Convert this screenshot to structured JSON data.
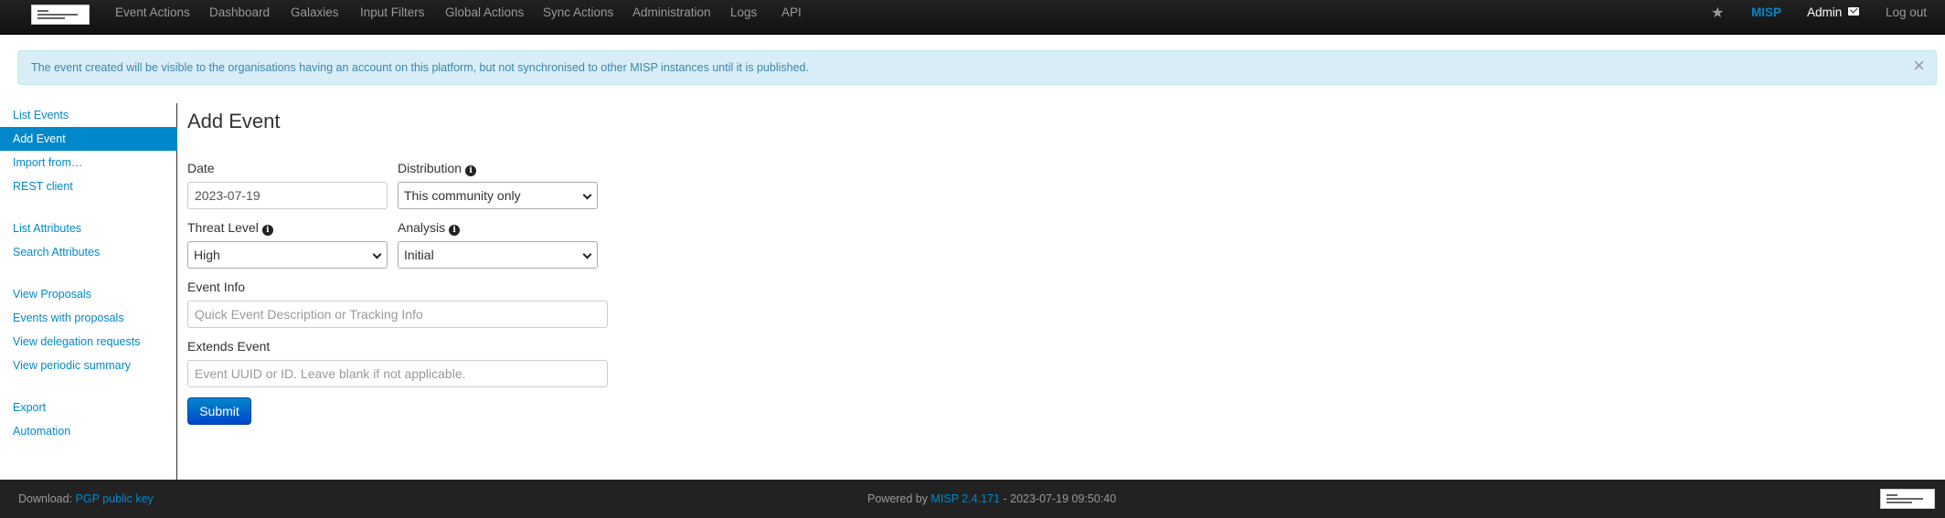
{
  "nav": {
    "items": [
      "Event Actions",
      "Dashboard",
      "Galaxies",
      "Input Filters",
      "Global Actions",
      "Sync Actions",
      "Administration",
      "Logs",
      "API"
    ],
    "misp": "MISP",
    "admin": "Admin",
    "logout": "Log out"
  },
  "alert": {
    "text": "The event created will be visible to the organisations having an account on this platform, but not synchronised to other MISP instances until it is published.",
    "close": "×"
  },
  "sidebar": {
    "items": [
      "List Events",
      "Add Event",
      "Import from…",
      "REST client",
      "List Attributes",
      "Search Attributes",
      "View Proposals",
      "Events with proposals",
      "View delegation requests",
      "View periodic summary",
      "Export",
      "Automation"
    ],
    "active": "Add Event"
  },
  "form": {
    "title": "Add Event",
    "date_label": "Date",
    "date_value": "2023-07-19",
    "distribution_label": "Distribution",
    "distribution_value": "This community only",
    "threat_label": "Threat Level",
    "threat_value": "High",
    "analysis_label": "Analysis",
    "analysis_value": "Initial",
    "info_label": "Event Info",
    "info_placeholder": "Quick Event Description or Tracking Info",
    "extends_label": "Extends Event",
    "extends_placeholder": "Event UUID or ID. Leave blank if not applicable.",
    "submit": "Submit"
  },
  "footer": {
    "download_prefix": "Download:",
    "pgp_link": "PGP public key",
    "powered_prefix": "Powered by",
    "misp_version": "MISP 2.4.171",
    "timestamp": "- 2023-07-19 09:50:40"
  },
  "colors": {
    "accent": "#0088cc",
    "navbar": "#1b1b1b",
    "alert_bg": "#d9edf7",
    "alert_text": "#3a87ad"
  }
}
